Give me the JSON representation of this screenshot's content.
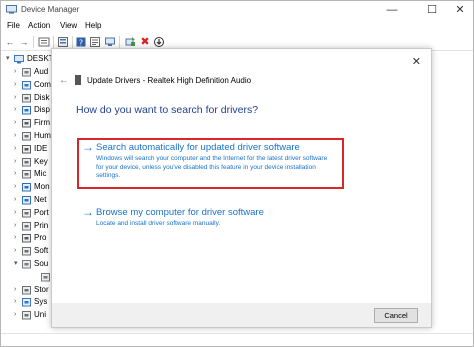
{
  "window": {
    "title": "Device Manager",
    "minimize": "—",
    "maximize": "☐",
    "close": "✕"
  },
  "menu": [
    "File",
    "Action",
    "View",
    "Help"
  ],
  "toolbar": {
    "back": "←",
    "forward": "→"
  },
  "tree": {
    "root": "DESKTOP",
    "items": [
      {
        "label": "Aud",
        "icon": "audio-icon",
        "color": "#7a7a7a"
      },
      {
        "label": "Com",
        "icon": "computer-icon",
        "color": "#3b76c4"
      },
      {
        "label": "Disk",
        "icon": "disk-icon",
        "color": "#6d6d6d"
      },
      {
        "label": "Disp",
        "icon": "display-icon",
        "color": "#2f6fb8"
      },
      {
        "label": "Firm",
        "icon": "firmware-icon",
        "color": "#5a5a5a"
      },
      {
        "label": "Hum",
        "icon": "hid-icon",
        "color": "#6d6d6d"
      },
      {
        "label": "IDE",
        "icon": "ide-icon",
        "color": "#5a5a5a"
      },
      {
        "label": "Key",
        "icon": "keyboard-icon",
        "color": "#6d6d6d"
      },
      {
        "label": "Mic",
        "icon": "mouse-icon",
        "color": "#6d6d6d"
      },
      {
        "label": "Mon",
        "icon": "monitor-icon",
        "color": "#2f6fb8"
      },
      {
        "label": "Net",
        "icon": "network-icon",
        "color": "#2f6fb8"
      },
      {
        "label": "Port",
        "icon": "port-icon",
        "color": "#6d6d6d"
      },
      {
        "label": "Prin",
        "icon": "print-icon",
        "color": "#6d6d6d"
      },
      {
        "label": "Pro",
        "icon": "processor-icon",
        "color": "#5a5a5a"
      },
      {
        "label": "Soft",
        "icon": "software-icon",
        "color": "#6d6d6d"
      },
      {
        "label": "Sou",
        "icon": "sound-icon",
        "color": "#7a7a7a",
        "expanded": true
      },
      {
        "label": "",
        "icon": "speaker-icon",
        "color": "#7a7a7a",
        "child": true
      },
      {
        "label": "Stor",
        "icon": "storage-icon",
        "color": "#6d6d6d"
      },
      {
        "label": "Sys",
        "icon": "system-icon",
        "color": "#3b76c4"
      },
      {
        "label": "Uni",
        "icon": "usb-icon",
        "color": "#6d6d6d"
      }
    ]
  },
  "dialog": {
    "close": "✕",
    "back": "←",
    "title": "Update Drivers - Realtek High Definition Audio",
    "question": "How do you want to search for drivers?",
    "options": [
      {
        "arrow": "→",
        "title": "Search automatically for updated driver software",
        "description": "Windows will search your computer and the Internet for the latest driver software for your device, unless you've disabled this feature in your device installation settings."
      },
      {
        "arrow": "→",
        "title": "Browse my computer for driver software",
        "description": "Locate and install driver software manually."
      }
    ],
    "cancel": "Cancel"
  },
  "colors": {
    "link_blue": "#1a73c9",
    "highlight_red": "#d9262a",
    "question_blue": "#1f3f8f"
  }
}
